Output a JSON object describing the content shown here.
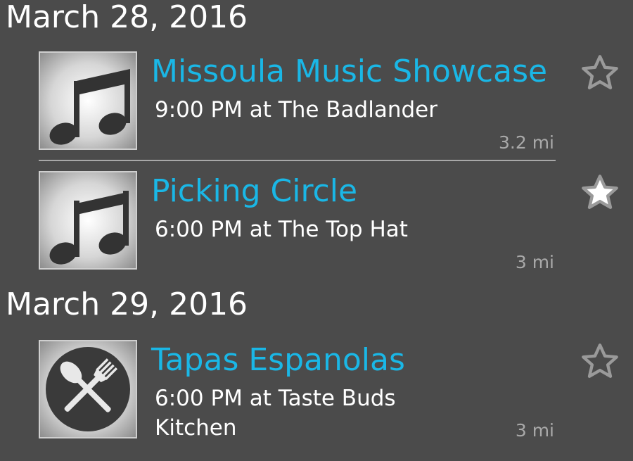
{
  "sections": [
    {
      "date": "March 28, 2016",
      "events": [
        {
          "title": "Missoula Music Showcase",
          "detail_line1": "9:00 PM at The Badlander",
          "detail_line2": "",
          "distance": "3.2 mi",
          "icon": "music-note-icon",
          "favorited": false
        },
        {
          "title": "Picking Circle",
          "detail_line1": "6:00 PM at The Top Hat",
          "detail_line2": "",
          "distance": "3 mi",
          "icon": "music-note-icon",
          "favorited": true
        }
      ]
    },
    {
      "date": "March 29, 2016",
      "events": [
        {
          "title": "Tapas Espanolas",
          "detail_line1": "6:00 PM at Taste Buds",
          "detail_line2": "Kitchen",
          "distance": "3 mi",
          "icon": "fork-spoon-icon",
          "favorited": false
        }
      ]
    }
  ],
  "colors": {
    "background": "#4b4b4b",
    "title": "#1ab7e6",
    "text": "#ffffff",
    "distance": "#a9a9a9",
    "star_outline": "#9a9a9a",
    "star_filled": "#ffffff"
  }
}
